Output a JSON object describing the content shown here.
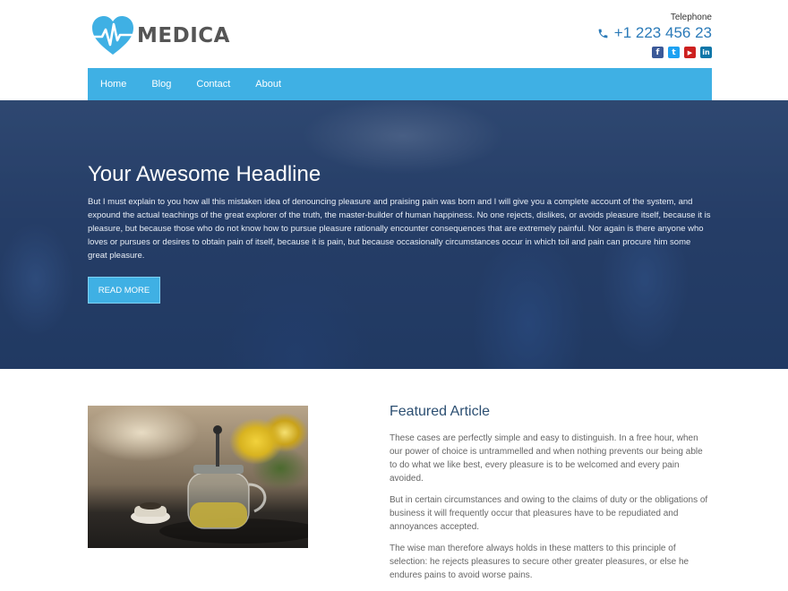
{
  "header": {
    "logo_text": "MEDICA",
    "telephone_label": "Telephone",
    "telephone_number": "+1 223 456 23",
    "socials": [
      {
        "name": "facebook",
        "glyph": "f",
        "color": "#3b5998"
      },
      {
        "name": "twitter",
        "glyph": "t",
        "color": "#1da1f2"
      },
      {
        "name": "youtube",
        "glyph": "▶",
        "color": "#cd201f"
      },
      {
        "name": "linkedin",
        "glyph": "in",
        "color": "#0e76a8"
      }
    ]
  },
  "nav": {
    "items": [
      "Home",
      "Blog",
      "Contact",
      "About"
    ]
  },
  "hero": {
    "title": "Your Awesome Headline",
    "text": "But I must explain to you how all this mistaken idea of denouncing pleasure and praising pain was born and I will give you a complete account of the system, and expound the actual teachings of the great explorer of the truth, the master-builder of human happiness. No one rejects, dislikes, or avoids pleasure itself, because it is pleasure, but because those who do not know how to pursue pleasure rationally encounter consequences that are extremely painful. Nor again is there anyone who loves or pursues or desires to obtain pain of itself, because it is pain, but because occasionally circumstances occur in which toil and pain can procure him some great pleasure.",
    "button_label": "READ MORE"
  },
  "featured": {
    "title": "Featured Article",
    "paragraphs": [
      "These cases are perfectly simple and easy to distinguish. In a free hour, when our power of choice is untrammelled and when nothing prevents our being able to do what we like best, every pleasure is to be welcomed and every pain avoided.",
      "But in certain circumstances and owing to the claims of duty or the obligations of business it will frequently occur that pleasures have to be repudiated and annoyances accepted.",
      "The wise man therefore always holds in these matters to this principle of selection: he rejects pleasures to secure other greater pleasures, or else he endures pains to avoid worse pains."
    ]
  },
  "colors": {
    "accent": "#3fb0e4",
    "logo_heart": "#3fb0e4",
    "phone": "#2a7ab8"
  }
}
